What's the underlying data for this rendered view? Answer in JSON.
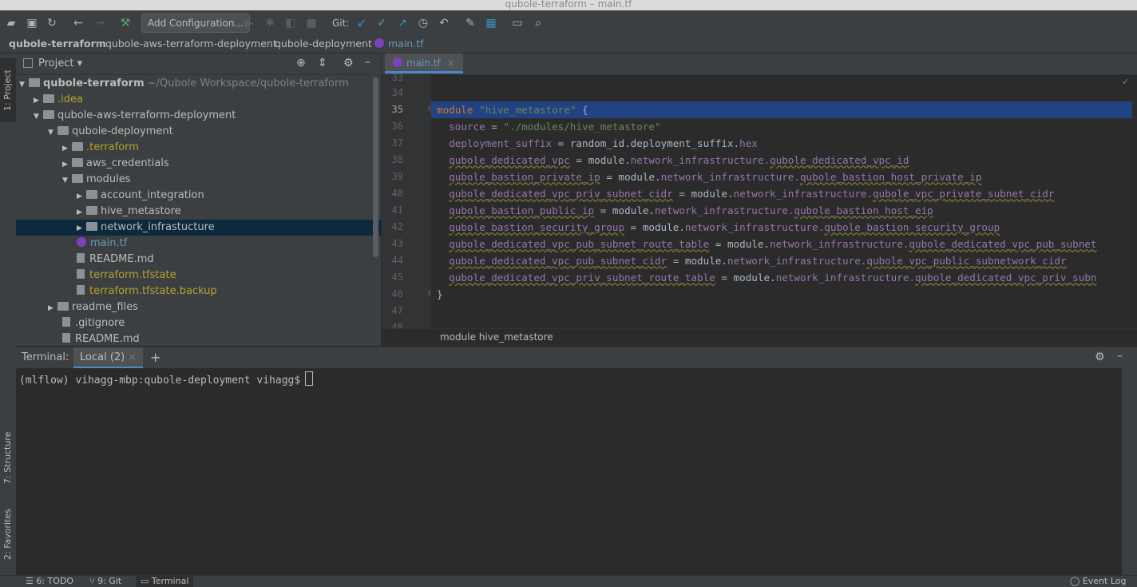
{
  "window": {
    "title": "qubole-terraform – main.tf"
  },
  "toolbar": {
    "add_configuration_label": "Add Configuration...",
    "git_label": "Git:",
    "icons": [
      "open-folder-icon",
      "save-icon",
      "sync-icon",
      "back-icon",
      "forward-icon",
      "build-hammer-icon",
      "run-icon",
      "debug-icon",
      "coverage-icon",
      "stop-icon",
      "git-update-icon",
      "git-commit-icon",
      "git-push-icon",
      "history-icon",
      "revert-icon",
      "settings-wrench-icon",
      "project-structure-icon",
      "terminal-icon",
      "search-icon"
    ]
  },
  "breadcrumbs": [
    "qubole-terraform",
    "qubole-aws-terraform-deployment",
    "qubole-deployment",
    "main.tf"
  ],
  "left_strip": {
    "project_tab": "1: Project",
    "structure_tab": "7: Structure",
    "favorites_tab": "2: Favorites"
  },
  "project": {
    "header_title": "Project",
    "root_name": "qubole-terraform",
    "root_path": "~/Qubole Workspace/qubole-terraform",
    "items": [
      {
        "label": ".idea"
      },
      {
        "label": "qubole-aws-terraform-deployment"
      },
      {
        "label": "qubole-deployment"
      },
      {
        "label": ".terraform"
      },
      {
        "label": "aws_credentials"
      },
      {
        "label": "modules"
      },
      {
        "label": "account_integration"
      },
      {
        "label": "hive_metastore"
      },
      {
        "label": "network_infrastucture"
      },
      {
        "label": "main.tf"
      },
      {
        "label": "README.md"
      },
      {
        "label": "terraform.tfstate"
      },
      {
        "label": "terraform.tfstate.backup"
      },
      {
        "label": "readme_files"
      },
      {
        "label": ".gitignore"
      },
      {
        "label": "README.md"
      }
    ]
  },
  "editor": {
    "tab_label": "main.tf",
    "line_numbers": [
      "33",
      "34",
      "35",
      "36",
      "37",
      "38",
      "39",
      "40",
      "41",
      "42",
      "43",
      "44",
      "45",
      "46",
      "47",
      "48"
    ],
    "code": {
      "l35_kw": "module",
      "l35_str": "\"hive_metastore\"",
      "l35_brace": "{",
      "l36_key": "source",
      "l36_val": "\"./modules/hive_metastore\"",
      "l37_key": "deployment_suffix",
      "l37_val": "random_id.deployment_suffix.",
      "l37_prop": "hex",
      "l38_key": "qubole_dedicated_vpc",
      "l38_mod": "module.",
      "l38_prop": "network_infrastructure.",
      "l38_ref": "qubole_dedicated_vpc_id",
      "l39_key": "qubole_bastion_private_ip",
      "l39_mod": "module.",
      "l39_prop": "network_infrastructure.",
      "l39_ref": "qubole_bastion_host_private_ip",
      "l40_key": "qubole_dedicated_vpc_priv_subnet_cidr",
      "l40_mod": "module.",
      "l40_prop": "network_infrastructure.",
      "l40_ref": "qubole_vpc_private_subnet_cidr",
      "l41_key": "qubole_bastion_public_ip",
      "l41_mod": "module.",
      "l41_prop": "network_infrastructure.",
      "l41_ref": "qubole_bastion_host_eip",
      "l42_key": "qubole_bastion_security_group",
      "l42_mod": "module.",
      "l42_prop": "network_infrastructure.",
      "l42_ref": "qubole_bastion_security_group",
      "l43_key": "qubole_dedicated_vpc_pub_subnet_route_table",
      "l43_mod": "module.",
      "l43_prop": "network_infrastructure.",
      "l43_ref": "qubole_dedicated_vpc_pub_subnet",
      "l44_key": "qubole_dedicated_vpc_pub_subnet_cidr",
      "l44_mod": "module.",
      "l44_prop": "network_infrastructure.",
      "l44_ref": "qubole_vpc_public_subnetwork_cidr",
      "l45_key": "qubole_dedicated_vpc_priv_subnet_route_table",
      "l45_mod": "module.",
      "l45_prop": "network_infrastructure.",
      "l45_ref": "qubole_dedicated_vpc_priv_subn",
      "l46_brace": "}"
    },
    "footer_breadcrumb": "module hive_metastore"
  },
  "terminal": {
    "label": "Terminal:",
    "tab_label": "Local (2)",
    "add_label": "+",
    "prompt": "(mlflow) vihagg-mbp:qubole-deployment vihagg$"
  },
  "statusbar": {
    "todo": "6: TODO",
    "git": "9: Git",
    "terminal": "Terminal",
    "event_log": "Event Log"
  },
  "colors": {
    "selection": "#214283",
    "tree_selection": "#0d293e",
    "keyword": "#cc7832",
    "string": "#6a8759",
    "property": "#9876aa",
    "tab_text": "#6897bb"
  }
}
